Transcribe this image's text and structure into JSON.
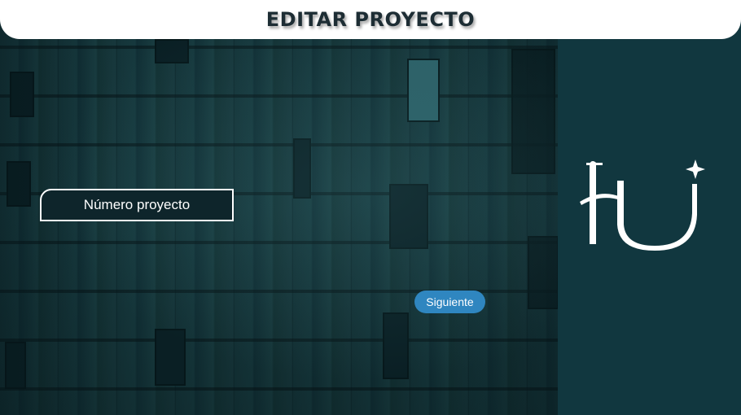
{
  "header": {
    "title": "EDITAR PROYECTO"
  },
  "form": {
    "project_number_label": "Número proyecto",
    "next_label": "Siguiente"
  },
  "logo": {
    "icon": "hu-monogram-logo",
    "color": "#ffffff"
  },
  "colors": {
    "panel": "#11373f",
    "button": "#2f86c0",
    "header_bg": "#ffffff"
  }
}
